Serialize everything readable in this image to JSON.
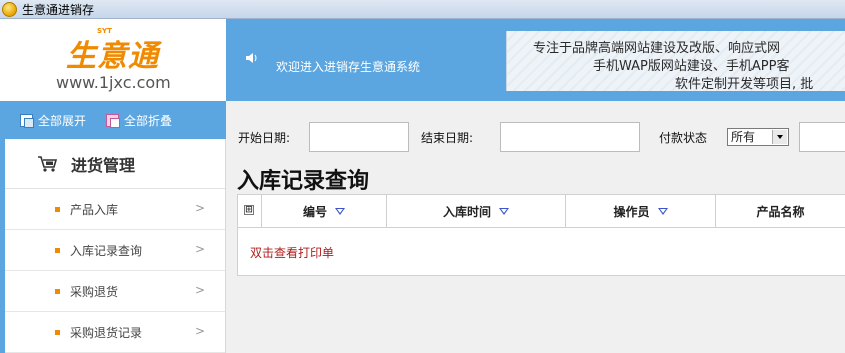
{
  "window": {
    "title": "生意通进销存"
  },
  "logo": {
    "brand": "生意通",
    "tag": "SYT",
    "url": "www.1jxc.com"
  },
  "header": {
    "welcome": "欢迎进入进销存生意通系统",
    "banner_lines": [
      "专注于品牌高端网站建设及改版、响应式网",
      "手机WAP版网站建设、手机APP客",
      "软件定制开发等项目, 批"
    ]
  },
  "sidebar": {
    "expand_all": "全部展开",
    "collapse_all": "全部折叠",
    "group": "进货管理",
    "items": [
      {
        "label": "产品入库",
        "arrow": ">"
      },
      {
        "label": "入库记录查询",
        "arrow": ">"
      },
      {
        "label": "采购退货",
        "arrow": ">"
      },
      {
        "label": "采购退货记录",
        "arrow": ">"
      }
    ]
  },
  "filters": {
    "start_date_label": "开始日期:",
    "start_date_value": "",
    "end_date_label": "结束日期:",
    "end_date_value": "",
    "payment_status_label": "付款状态",
    "payment_status_value": "所有"
  },
  "main": {
    "title": "入库记录查询",
    "grid": {
      "expander": "⊞",
      "columns": [
        "编号",
        "入库时间",
        "操作员",
        "产品名称"
      ],
      "hint": "双击查看打印单"
    }
  },
  "colors": {
    "accent": "#5ba6e0",
    "brand": "#f08a00",
    "hint": "#b21b1b"
  }
}
